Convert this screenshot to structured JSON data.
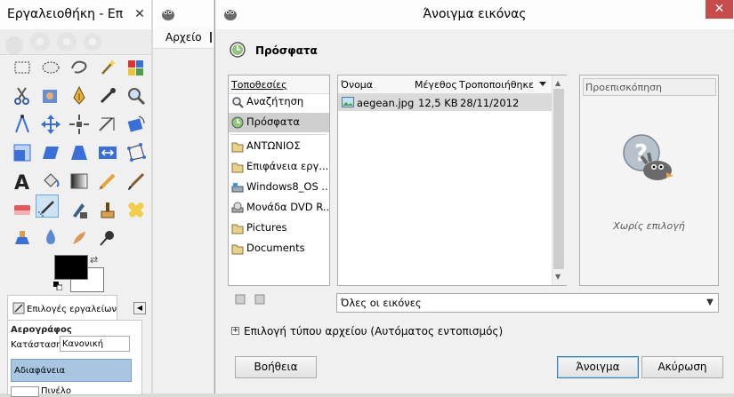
{
  "toolbox": {
    "title": "Εργαλειοθήκη - Επ",
    "close_label": "✕",
    "tab_label": "Επιλογές εργαλείων",
    "options": {
      "tool_name": "Αερογράφος",
      "mode_label": "Κατάσταση:",
      "mode_value": "Κανονική",
      "opacity_label": "Αδιαφάνεια",
      "brush_label": "Πινέλο"
    }
  },
  "image_window": {
    "menu_file": "Αρχείο"
  },
  "dialog": {
    "title": "Άνοιγμα εικόνας",
    "close_label": "✕",
    "location_title": "Πρόσφατα",
    "places_header": "Τοποθεσίες",
    "places": [
      {
        "label": "Αναζήτηση",
        "icon": "search-icon"
      },
      {
        "label": "Πρόσφατα",
        "icon": "recent-icon",
        "selected": true
      },
      {
        "label": "ΑΝΤΩΝΙΟΣ",
        "icon": "folder-icon"
      },
      {
        "label": "Επιφάνεια εργ...",
        "icon": "folder-icon"
      },
      {
        "label": "Windows8_OS ...",
        "icon": "drive-icon"
      },
      {
        "label": "Μονάδα DVD R...",
        "icon": "dvd-icon"
      },
      {
        "label": "Pictures",
        "icon": "folder-icon"
      },
      {
        "label": "Documents",
        "icon": "folder-icon"
      }
    ],
    "columns": {
      "name": "Όνομα",
      "size": "Μέγεθος",
      "modified": "Τροποποιήθηκε"
    },
    "files": [
      {
        "name": "aegean.jpg",
        "size": "12,5 KB",
        "modified": "28/11/2012"
      }
    ],
    "preview_label": "Προεπισκόπηση",
    "preview_none": "Χωρίς επιλογή",
    "filter_value": "Όλες οι εικόνες",
    "expander_label": "Επιλογή τύπου αρχείου (Αυτόματος εντοπισμός)",
    "buttons": {
      "help": "Βοήθεια",
      "open": "Άνοιγμα",
      "cancel": "Ακύρωση"
    }
  },
  "colors": {
    "accent_open_border": "#3c7fb1",
    "close_button": "#c74d4d",
    "selection": "#dadada"
  }
}
